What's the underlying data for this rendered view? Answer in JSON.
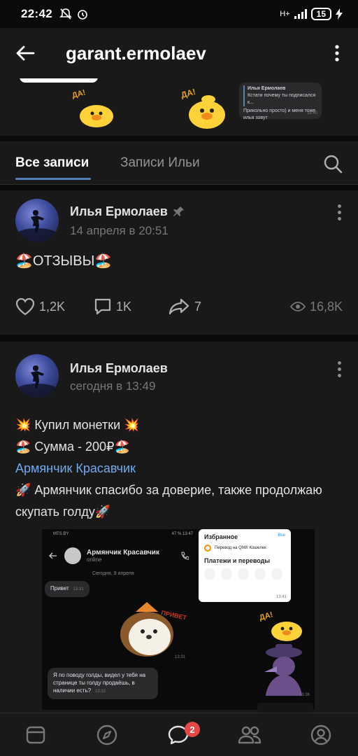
{
  "status_bar": {
    "time": "22:42",
    "network": "H+",
    "battery": "15"
  },
  "header": {
    "title": "garant.ermolaev"
  },
  "top_strip": {
    "sticker_text": "ДА!",
    "card_name": "Илья Ермолаев",
    "card_quote": "Кстати почему ты подписался к...",
    "card_text": "Прикольно просто) и меня тоже илья зовут",
    "card_time": "18:40"
  },
  "tabs": {
    "all": "Все записи",
    "author": "Записи Ильи"
  },
  "post1": {
    "author": "Илья Ермолаев",
    "date": "14 апреля в 20:51",
    "text": "🏖️ОТЗЫВЫ🏖️",
    "likes": "1,2K",
    "comments": "1K",
    "shares": "7",
    "views": "16,8K"
  },
  "post2": {
    "author": "Илья Ермолаев",
    "date": "сегодня в 13:49",
    "line1": "💥 Купил монетки 💥",
    "line2": "🏖️ Сумма - 200₽🏖️",
    "mention": "Армянчик Красавчик",
    "line3": "🚀 Армянчик спасибо за доверие, также продолжаю скупать голду🚀",
    "attachment": {
      "status_left": "MTS.BY",
      "status_right": "47 % 13:47",
      "chat_name": "Армянчик Красавчик",
      "chat_status": "online",
      "date_sep": "Сегодня, 9 апреля",
      "msg1": "Привет",
      "msg1_time": "13:31",
      "sticker_text": "ПРИВЕТ",
      "sticker_time": "13:31",
      "msg2": "Я по поводу голды, видел у тебя на странице ты голду продаёшь, в наличии есть?",
      "msg2_time": "13:32",
      "sticker2_text": "ДА!",
      "sticker2_time": "13:36",
      "qiwi_fav": "Избранное",
      "qiwi_all": "Все",
      "qiwi_transfer": "Перевод на QIWI Кошелек",
      "qiwi_payments": "Платежи и переводы",
      "qiwi_time": "13:41"
    }
  },
  "bottom_nav": {
    "badge": "2"
  },
  "colors": {
    "accent": "#5181b8",
    "link": "#71aaeb",
    "badge": "#e64646",
    "bg": "#19191a"
  }
}
